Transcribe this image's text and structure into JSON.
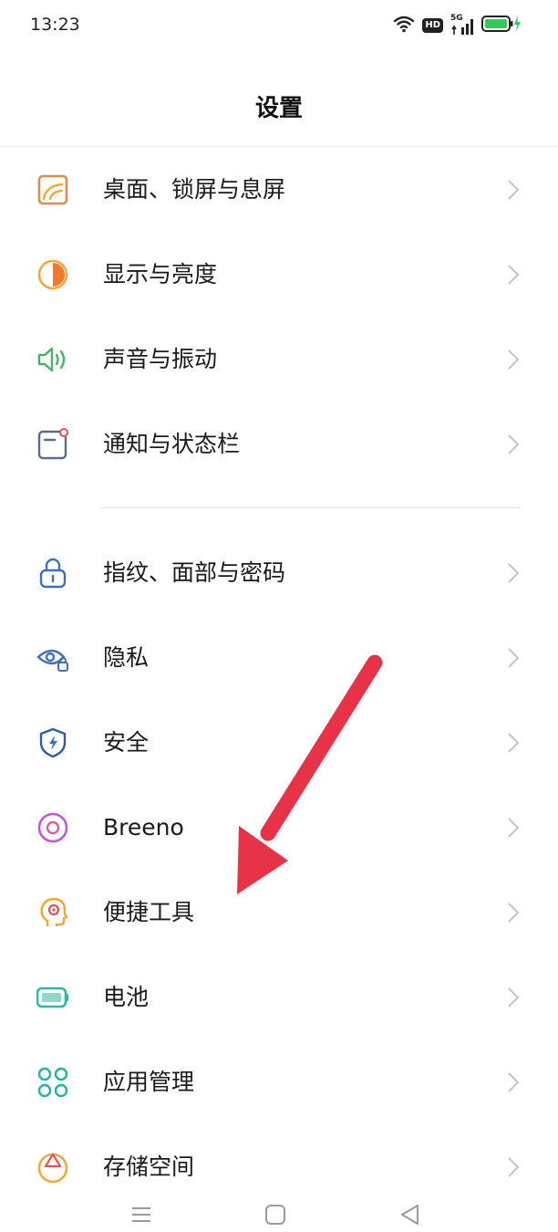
{
  "status_bar": {
    "time": "13:23",
    "hd_label": "HD",
    "network_label": "5G"
  },
  "header": {
    "title": "设置"
  },
  "settings": {
    "items": [
      {
        "label": "桌面、锁屏与息屏",
        "icon": "wallpaper-icon",
        "color": "#e08a4c"
      },
      {
        "label": "显示与亮度",
        "icon": "brightness-icon",
        "color": "#f2a93b"
      },
      {
        "label": "声音与振动",
        "icon": "speaker-icon",
        "color": "#4caf6a"
      },
      {
        "label": "通知与状态栏",
        "icon": "notification-icon",
        "color": "#5a6b8c"
      },
      {
        "label": "指纹、面部与密码",
        "icon": "lock-icon",
        "color": "#3f6fb8"
      },
      {
        "label": "隐私",
        "icon": "privacy-eye-icon",
        "color": "#3f6fb8"
      },
      {
        "label": "安全",
        "icon": "shield-icon",
        "color": "#2f5aa6"
      },
      {
        "label": "Breeno",
        "icon": "breeno-icon",
        "color": "#c455d6"
      },
      {
        "label": "便捷工具",
        "icon": "tools-head-icon",
        "color": "#f0a830"
      },
      {
        "label": "电池",
        "icon": "battery-icon",
        "color": "#2db8a0"
      },
      {
        "label": "应用管理",
        "icon": "apps-icon",
        "color": "#26b3a3"
      },
      {
        "label": "存储空间",
        "icon": "storage-icon",
        "color": "#f2a93b"
      }
    ]
  },
  "annotation": {
    "arrow_color": "#e83248"
  }
}
